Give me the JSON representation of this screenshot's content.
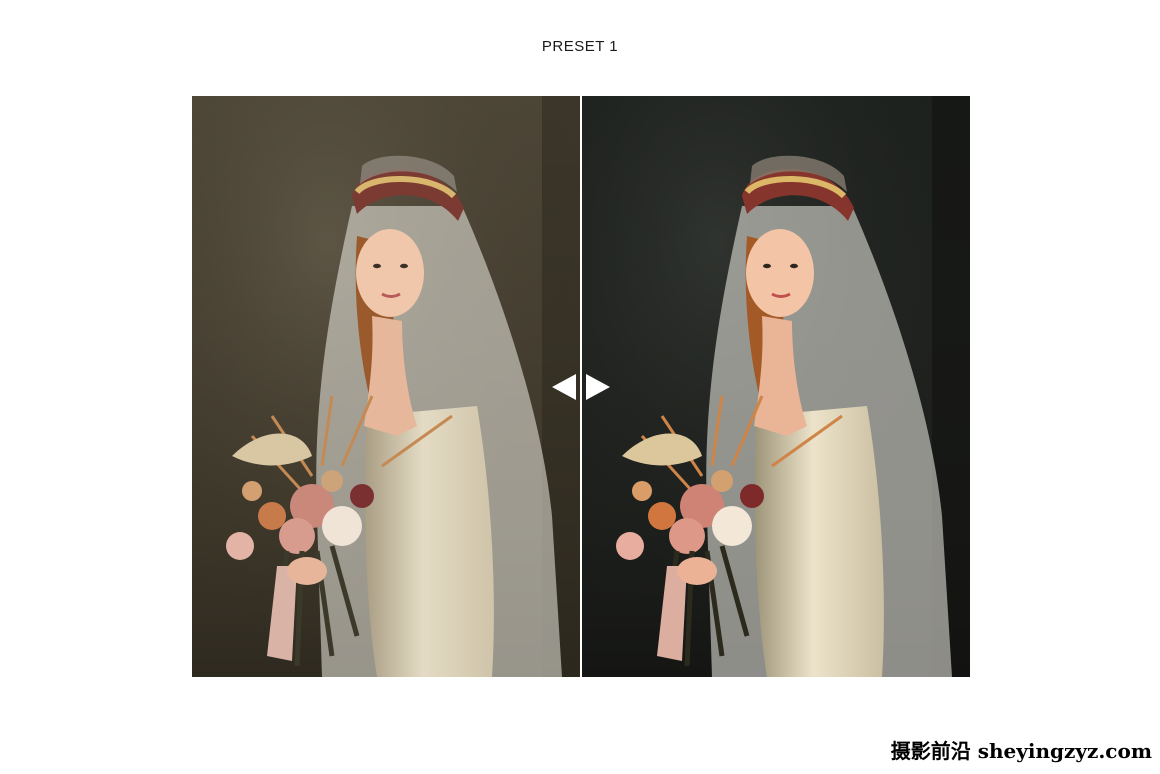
{
  "title": "PRESET 1",
  "comparison": {
    "before_alt": "Bride in lace veil holding bouquet - original",
    "after_alt": "Bride in lace veil holding bouquet - with preset",
    "prev_icon": "triangle-left-icon",
    "next_icon": "triangle-right-icon"
  },
  "watermark": "摄影前沿 sheyingzyz.com",
  "colors": {
    "before_background": "#463f31",
    "after_background": "#1f221f",
    "arrows": "#ffffff"
  }
}
